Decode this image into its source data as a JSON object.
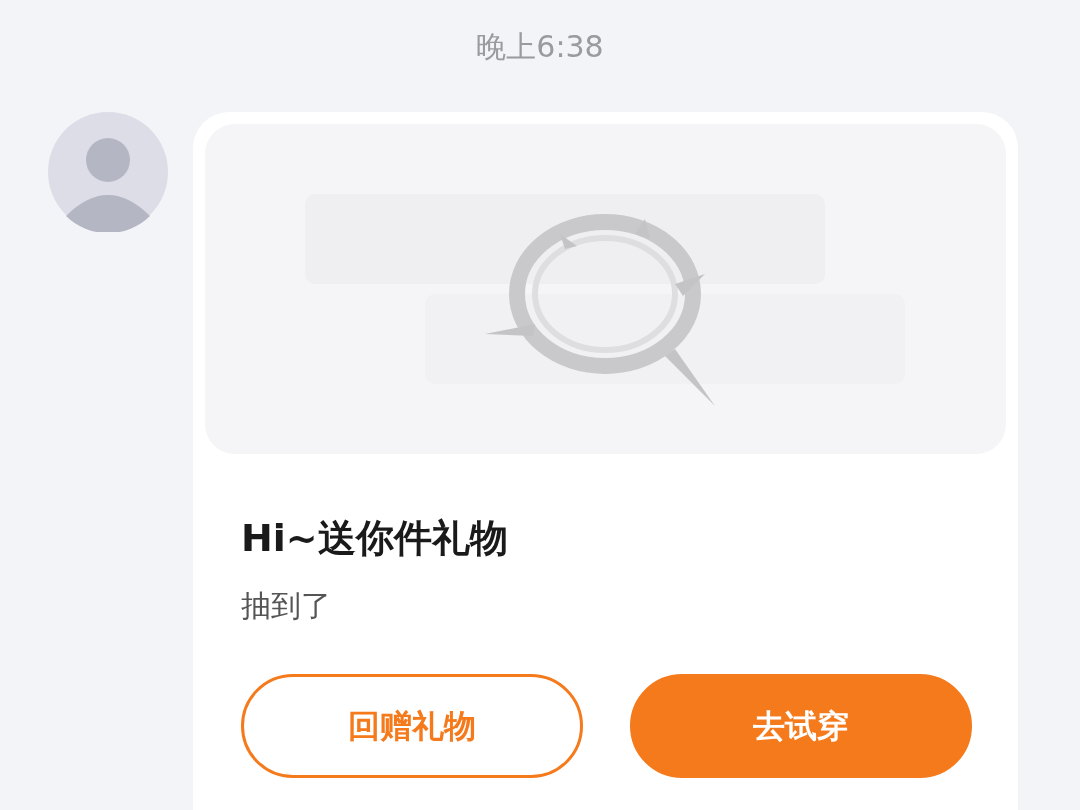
{
  "time": "晚上6:38",
  "card": {
    "title": "Hi~送你件礼物",
    "subtitle": "抽到了",
    "buttons": [
      {
        "label": "回赠礼物",
        "kind": "outline"
      },
      {
        "label": "去试穿",
        "kind": "filled"
      }
    ]
  }
}
